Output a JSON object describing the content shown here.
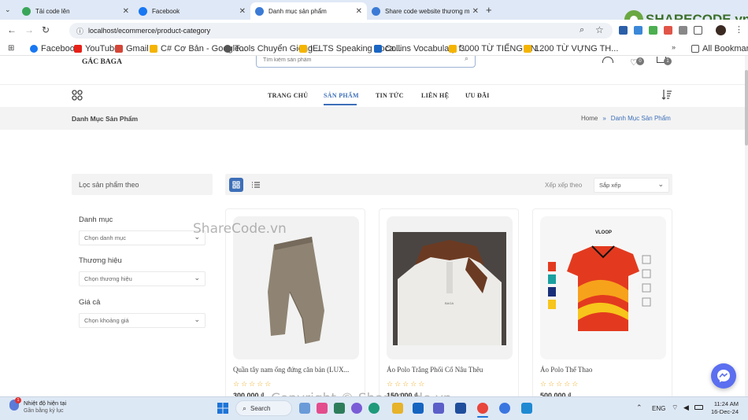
{
  "browser": {
    "tabs": [
      {
        "title": "Tải code lên",
        "color": "#3aa65a"
      },
      {
        "title": "Facebook",
        "color": "#1877f2"
      },
      {
        "title": "Danh mục sản phẩm",
        "color": "#3b7bd6"
      },
      {
        "title": "Share code website thương mại",
        "color": "#3b7bd6"
      }
    ],
    "url": "localhost/ecommerce/product-category",
    "bookmarks": [
      "Facebook",
      "YouTube",
      "Gmail",
      "C# Cơ Bản - Google...",
      "Tools Chuyển Giong...",
      "IELTS Speaking Voca...",
      "Collins Vocabulary f...",
      "3000 TỪ TIẾNG AN...",
      "1200 TỪ VỰNG TH..."
    ],
    "all_bookmarks": "All Bookmarks"
  },
  "site": {
    "logo_line": "GÁC BAGA",
    "search_placeholder": "Tìm kiếm sản phẩm",
    "wishlist_count": "0",
    "cart_count": "1",
    "nav": [
      "TRANG CHỦ",
      "SẢN PHẨM",
      "TIN TỨC",
      "LIÊN HỆ",
      "ƯU ĐÃI"
    ],
    "active_nav": "SẢN PHẨM",
    "page_title": "Danh Mục Sản Phẩm",
    "breadcrumb_home": "Home",
    "breadcrumb_sep": "»",
    "breadcrumb_current": "Danh Mục Sản Phẩm"
  },
  "filters": {
    "heading": "Lọc sản phẩm theo",
    "groups": [
      {
        "label": "Danh mục",
        "value": "Chọn danh mục"
      },
      {
        "label": "Thương hiệu",
        "value": "Chọn thương hiệu"
      },
      {
        "label": "Giá cả",
        "value": "Chọn khoảng giá"
      }
    ]
  },
  "sorting": {
    "label": "Xếp xếp theo",
    "value": "Sắp xếp"
  },
  "products": [
    {
      "name": "Quần tây nam ống đứng căn bản (LUX...",
      "price": "300.000 ₫",
      "rating": 0
    },
    {
      "name": "Áo Polo Trắng Phối Cổ Nâu Thêu",
      "price": "150.000 ₫",
      "rating": 0
    },
    {
      "name": "Áo Polo Thể Thao",
      "price": "500.000 ₫",
      "rating": 0
    }
  ],
  "watermarks": {
    "logo": "SHARECODE.vn",
    "mid": "ShareCode.vn",
    "bottom": "Copyright © ShareCode.vn"
  },
  "taskbar": {
    "weather_title": "Nhiệt độ hiện tại",
    "weather_sub": "Gần bằng kỷ lục",
    "search": "Search",
    "lang": "ENG",
    "time": "11:24 AM",
    "date": "16-Dec-24"
  }
}
